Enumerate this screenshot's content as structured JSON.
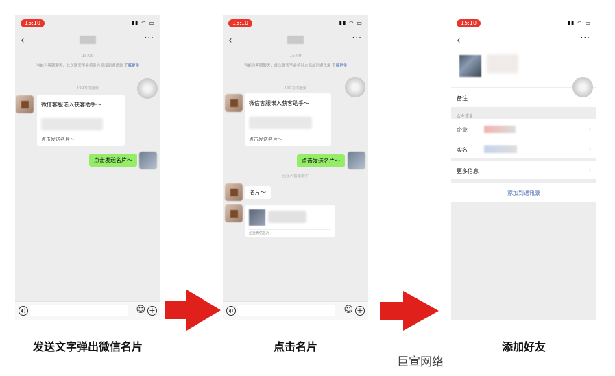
{
  "panels": [
    {
      "status_time": "15:10",
      "status_icons": "▮▮ ◠ ▭",
      "timestamp": "15:09",
      "notice_text": "当前为客服聊天，此次聊天不会将对方添加到通讯录",
      "notice_link": "了解更多",
      "system_line": "199为你服务",
      "card_title": "微信客服嵌入获客助手～",
      "card_footer": "点击发送名片～",
      "green_message": "点击发送名片～"
    },
    {
      "status_time": "15:10",
      "status_icons": "▮▮ ◠ ▭",
      "timestamp": "15:09",
      "notice_text": "当前为客服聊天，此次聊天不会将对方添加到通讯录",
      "notice_link": "了解更多",
      "system_line": "199为你服务",
      "card_title": "微信客服嵌入获客助手～",
      "card_footer": "点击发送名片～",
      "green_message": "点击发送名片～",
      "system_line_2": "已接入智能助手",
      "white_message": "名片～",
      "namecard_footer": "企业微信名片"
    },
    {
      "status_time": "15:10",
      "status_icons": "▮▮ ◠ ▭",
      "remark_label": "备注",
      "section_label": "企业信息",
      "company_label": "企业",
      "realname_label": "实名",
      "more_info_label": "更多信息",
      "add_contact_label": "添加到通讯录"
    }
  ],
  "captions": [
    "发送文字弹出微信名片",
    "点击名片",
    "添加好友"
  ],
  "watermark": "巨宣网络",
  "colors": {
    "arrow": "#e0201a",
    "status_pill": "#e8362c",
    "bubble_green": "#95ec69",
    "link": "#4b6fb4"
  },
  "icons": [
    "back-icon",
    "more-icon",
    "voice-icon",
    "emoji-icon",
    "plus-icon",
    "chevron-right-icon",
    "right-arrow-icon"
  ]
}
